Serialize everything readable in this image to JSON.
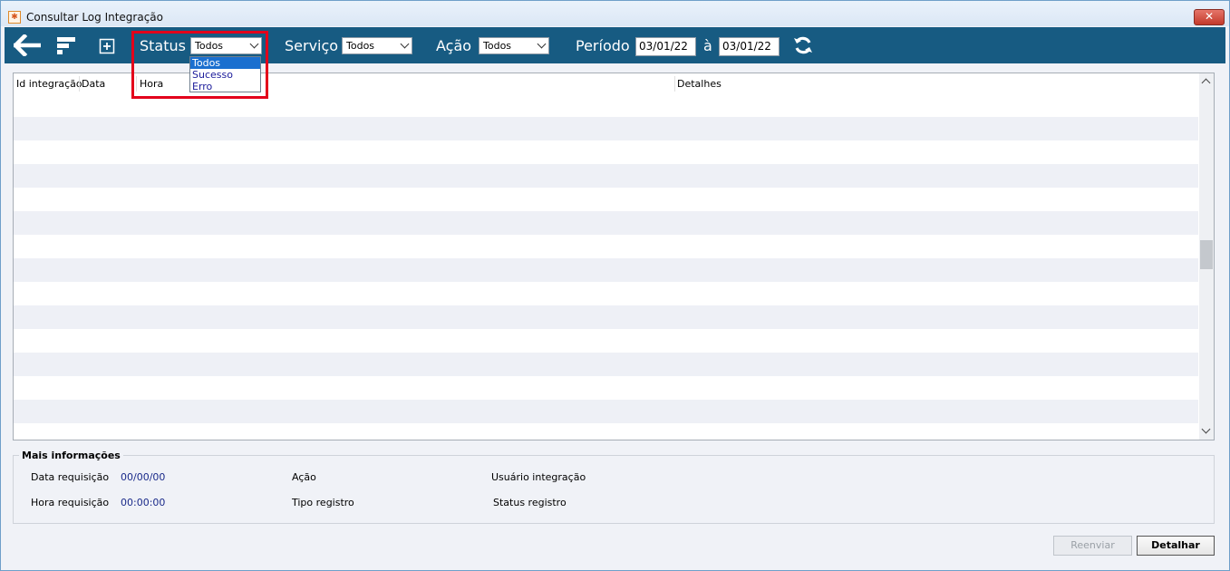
{
  "window": {
    "title": "Consultar Log Integração",
    "close_symbol": "✕"
  },
  "toolbar": {
    "status_label": "Status",
    "status_value": "Todos",
    "servico_label": "Serviço",
    "servico_value": "Todos",
    "acao_label": "Ação",
    "acao_value": "Todos",
    "periodo_label": "Período",
    "date_from": "03/01/22",
    "date_sep": "à",
    "date_to": "03/01/22",
    "icons": [
      "back-arrow-icon",
      "filter-icon",
      "expand-plus-icon",
      "refresh-icon"
    ]
  },
  "status_dropdown": {
    "options": [
      "Todos",
      "Sucesso",
      "Erro"
    ],
    "selected": "Todos"
  },
  "grid": {
    "columns": [
      "Id integração",
      "Data",
      "Hora",
      "Detalhes"
    ],
    "row_count": 14
  },
  "details": {
    "legend": "Mais informações",
    "data_requisicao_label": "Data requisição",
    "data_requisicao_value": "00/00/00",
    "hora_requisicao_label": "Hora requisição",
    "hora_requisicao_value": "00:00:00",
    "acao_label": "Ação",
    "tipo_registro_label": "Tipo registro",
    "usuario_integracao_label": "Usuário integração",
    "status_registro_label": "Status registro"
  },
  "buttons": {
    "reenviar": "Reenviar",
    "detalhar": "Detalhar"
  },
  "colors": {
    "toolbar": "#175b82",
    "highlight": "#e3001b",
    "selection": "#1a6fcf"
  }
}
